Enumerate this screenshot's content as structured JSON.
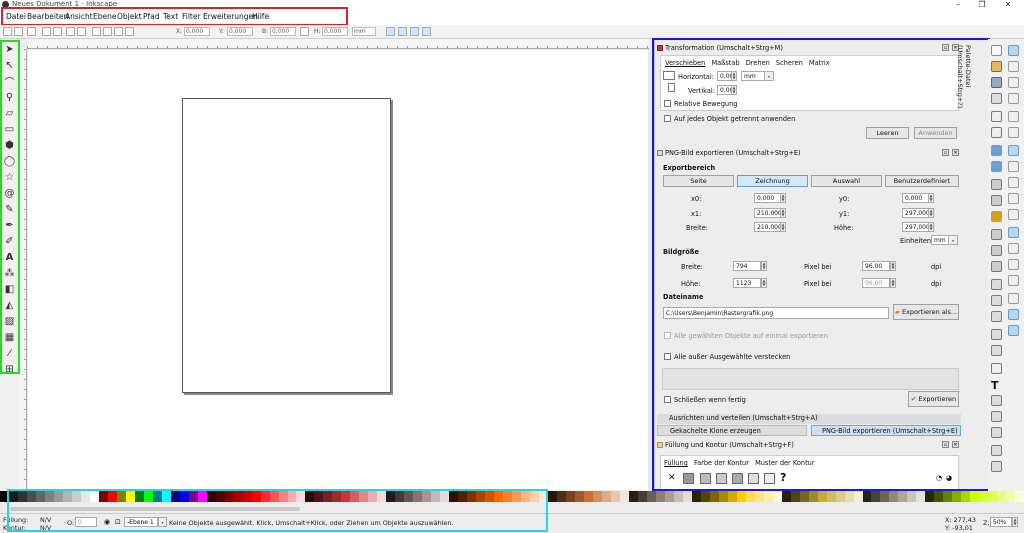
{
  "window": {
    "title": "Neues Dokument 1 - Inkscape",
    "controls": [
      "–",
      "❐",
      "✕"
    ]
  },
  "menu": [
    "Datei",
    "Bearbeiten",
    "Ansicht",
    "Ebene",
    "Objekt",
    "Pfad",
    "Text",
    "Filter",
    "Erweiterungen",
    "Hilfe"
  ],
  "tool_controls": {
    "x_label": "X:",
    "x_value": "0,000",
    "y_label": "Y:",
    "y_value": "0,000",
    "w_label": "B:",
    "w_value": "0,000",
    "h_label": "H:",
    "h_value": "0,000",
    "unit": "mm"
  },
  "transform_dialog": {
    "title": "Transformation (Umschalt+Strg+M)",
    "tabs": [
      "Verschieben",
      "Maßstab",
      "Drehen",
      "Scheren",
      "Matrix"
    ],
    "horizontal_label": "Horizontal:",
    "horizontal_value": "0,000",
    "vertical_label": "Vertikal:",
    "vertical_value": "0,000",
    "unit": "mm",
    "relative_label": "Relative Bewegung",
    "separately_label": "Auf jedes Objekt getrennt anwenden",
    "clear_button": "Leeren",
    "apply_button": "Anwenden"
  },
  "png_dialog": {
    "title": "PNG-Bild exportieren (Umschalt+Strg+E)",
    "area_heading": "Exportbereich",
    "area_buttons": [
      "Seite",
      "Zeichnung",
      "Auswahl",
      "Benutzerdefiniert"
    ],
    "x0_label": "x0:",
    "x0_value": "0,000",
    "y0_label": "y0:",
    "y0_value": "0,000",
    "x1_label": "x1:",
    "x1_value": "210,000",
    "y1_label": "y1:",
    "y1_value": "297,000",
    "width_label": "Breite:",
    "width_value": "210,000",
    "height_label": "Höhe:",
    "height_value": "297,000",
    "units_label": "Einheiten:",
    "units_value": "mm",
    "size_heading": "Bildgröße",
    "px_width_label": "Breite:",
    "px_width_value": "794",
    "px_height_label": "Höhe:",
    "px_height_value": "1123",
    "dpi_label": "Pixel bei",
    "dpi_value": "96,00",
    "dpi_unit": "dpi",
    "dpi2_label": "Pixel bei",
    "dpi2_value": "96,00",
    "dpi2_unit": "dpi",
    "filename_heading": "Dateiname",
    "filename_value": "C:\\Users\\Benjamin\\Rastergrafik.png",
    "export_as_button": "Exportieren als...",
    "batch_label": "Alle gewählten Objekte auf einmal exportieren",
    "hide_label": "Alle außer Ausgewählte verstecken",
    "close_label": "Schließen wenn fertig",
    "export_button": "Exportieren"
  },
  "collapsed_dialogs": {
    "align": "Ausrichten und verteilen (Umschalt+Strg+A)",
    "clones": "Gekachelte Klone erzeugen",
    "png_tab": "PNG-Bild exportieren (Umschalt+Strg+E)"
  },
  "fill_dialog": {
    "title": "Füllung und Kontur (Umschalt+Strg+F)",
    "tabs": [
      "Füllung",
      "Farbe der Kontur",
      "Muster der Kontur"
    ],
    "unset": "?"
  },
  "side_tab": "Palette-Datei (Umschalt+Strg+?)",
  "palette_colors": [
    "#000000",
    "#1a1a1a",
    "#333333",
    "#4d4d4d",
    "#666666",
    "#808080",
    "#999999",
    "#b3b3b3",
    "#cccccc",
    "#e6e6e6",
    "#ffffff",
    "#800000",
    "#ff0000",
    "#808000",
    "#ffff00",
    "#008000",
    "#00ff00",
    "#008080",
    "#00ffff",
    "#000080",
    "#0000ff",
    "#800080",
    "#ff00ff",
    "#2b0000",
    "#550000",
    "#800000",
    "#aa0000",
    "#d40000",
    "#ff0000",
    "#ff2a2a",
    "#ff5555",
    "#ff8080",
    "#ffaaaa",
    "#ffd5d5",
    "#280b0b",
    "#501616",
    "#782121",
    "#a02c2c",
    "#c83737",
    "#d35f5f",
    "#de8787",
    "#e9afaf",
    "#f4d7d7",
    "#241c1c",
    "#483737",
    "#6c5353",
    "#916f6f",
    "#ac9393",
    "#c8b7b7",
    "#e3dbdb",
    "#2b1100",
    "#552200",
    "#803300",
    "#aa4400",
    "#d45500",
    "#ff6600",
    "#ff7f2a",
    "#ff9955",
    "#ffb380",
    "#ffccaa",
    "#ffe6d5",
    "#28170b",
    "#502d16",
    "#784421",
    "#a05a2c",
    "#c87137",
    "#d38d5f",
    "#deaa87",
    "#e9c6af",
    "#f4e3d7",
    "#241f1c",
    "#483e37",
    "#6c5d53",
    "#917c6f",
    "#ac9d93",
    "#c8beb7",
    "#e3dedb",
    "#2b2200",
    "#554400",
    "#806600",
    "#aa8800",
    "#d4aa00",
    "#ffcc00",
    "#ffdd55",
    "#ffe680",
    "#ffeeaa",
    "#fff6d5",
    "#28220b",
    "#504416",
    "#786721",
    "#a0892c",
    "#c8ab37",
    "#d3bc5f",
    "#decd87",
    "#e9ddaf",
    "#f4eed7",
    "#24221c",
    "#484537",
    "#6c6753",
    "#918a6f",
    "#aca793",
    "#c8c4b7",
    "#e3e2db",
    "#222b00",
    "#445500",
    "#668000",
    "#88aa00",
    "#aad400",
    "#ccff00",
    "#d4ff2a",
    "#ddff55",
    "#e5ff80",
    "#eeffaa",
    "#f6ffd5"
  ],
  "status": {
    "fill_label": "Füllung:",
    "fill_value": "N/V",
    "stroke_label": "Kontur:",
    "stroke_value": "N/V",
    "opacity_label": "O:",
    "opacity_value": "0",
    "layer": "-Ebene 1",
    "message": "Keine Objekte ausgewählt. Klick, Umschalt+Klick, oder Ziehen um Objekte auszuwählen.",
    "x_coord": "X: 277,43",
    "y_coord": "Y: -93,01",
    "zoom_label": "Z:",
    "zoom_value": "50%"
  }
}
